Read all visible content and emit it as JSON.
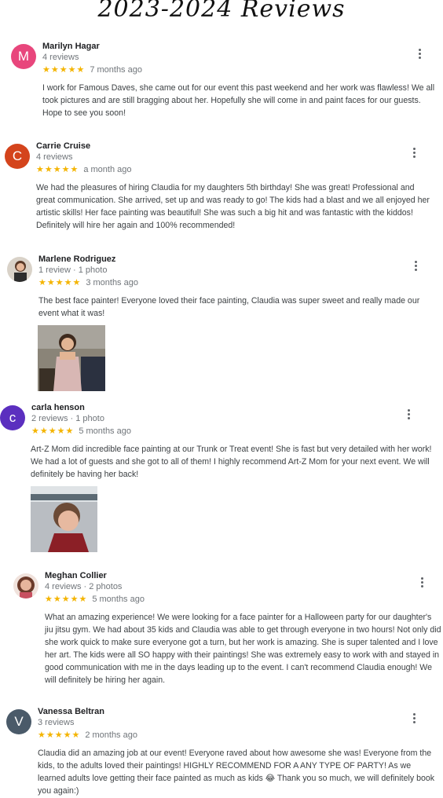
{
  "page_title": "2023-2024 Reviews",
  "colors": {
    "star": "#f4b400",
    "text": "#3c4043",
    "muted": "#70757a"
  },
  "reviews": [
    {
      "author": "Marilyn Hagar",
      "meta": "4 reviews",
      "stars": "★★★★★",
      "time": "7 months ago",
      "avatar_letter": "M",
      "avatar_color": "#e8467c",
      "text": "I work for Famous Daves, she came out for our event this past weekend and her work was flawless! We all took pictures and are still bragging about her. Hopefully she will come in and paint faces for our guests. Hope to see you soon!"
    },
    {
      "author": "Carrie Cruise",
      "meta": "4 reviews",
      "stars": "★★★★★",
      "time": "a month ago",
      "avatar_letter": "C",
      "avatar_color": "#d4441c",
      "text": "We had the pleasures of hiring Claudia for my daughters 5th birthday!  She was great!  Professional and great communication.  She arrived, set up and was ready to go!  The kids had a blast and we all enjoyed her artistic skills!  Her face painting was beautiful!  She was such a big hit and was fantastic with the kiddos!  Definitely will hire her again and 100% recommended!"
    },
    {
      "author": "Marlene Rodriguez",
      "meta": "1 review · 1 photo",
      "stars": "★★★★★",
      "time": "3 months ago",
      "text": "The best face painter! Everyone loved their face painting, Claudia was super sweet and really made our event what it was!"
    },
    {
      "author": "carla henson",
      "meta": "2 reviews · 1 photo",
      "stars": "★★★★★",
      "time": "5 months ago",
      "avatar_letter": "c",
      "avatar_color": "#5b2fbf",
      "text": "Art-Z Mom did incredible face painting at our Trunk or Treat event! She is fast but very detailed with her work! We had a lot of guests and she got to all of them! I highly recommend Art-Z Mom for your next event. We will definitely be having her back!"
    },
    {
      "author": "Meghan Collier",
      "meta": "4 reviews · 2 photos",
      "stars": "★★★★★",
      "time": "5 months ago",
      "text": "What an amazing experience! We were looking for a face painter for a Halloween party for our daughter's jiu jitsu gym. We had about 35 kids and Claudia was able to get through everyone in two hours! Not only did she work quick to make sure everyone got a turn, but her work is amazing. She is super talented and I love her art. The kids were all SO happy with their paintings! She was extremely easy to work with and stayed in good communication with me in the days leading up to the event. I can't recommend Claudia enough! We will definitely be hiring her again."
    },
    {
      "author": "Vanessa Beltran",
      "meta": "3 reviews",
      "stars": "★★★★★",
      "time": "2 months ago",
      "avatar_letter": "V",
      "avatar_color": "#4a5a69",
      "text": "Claudia did an amazing job at our event! Everyone raved about how awesome she was! Everyone from the kids, to the adults loved their paintings! HIGHLY RECOMMEND FOR A ANY TYPE OF PARTY! As we learned adults love getting their face painted as much as kids 😂 Thank you so much, we will definitely book you again:)"
    }
  ]
}
